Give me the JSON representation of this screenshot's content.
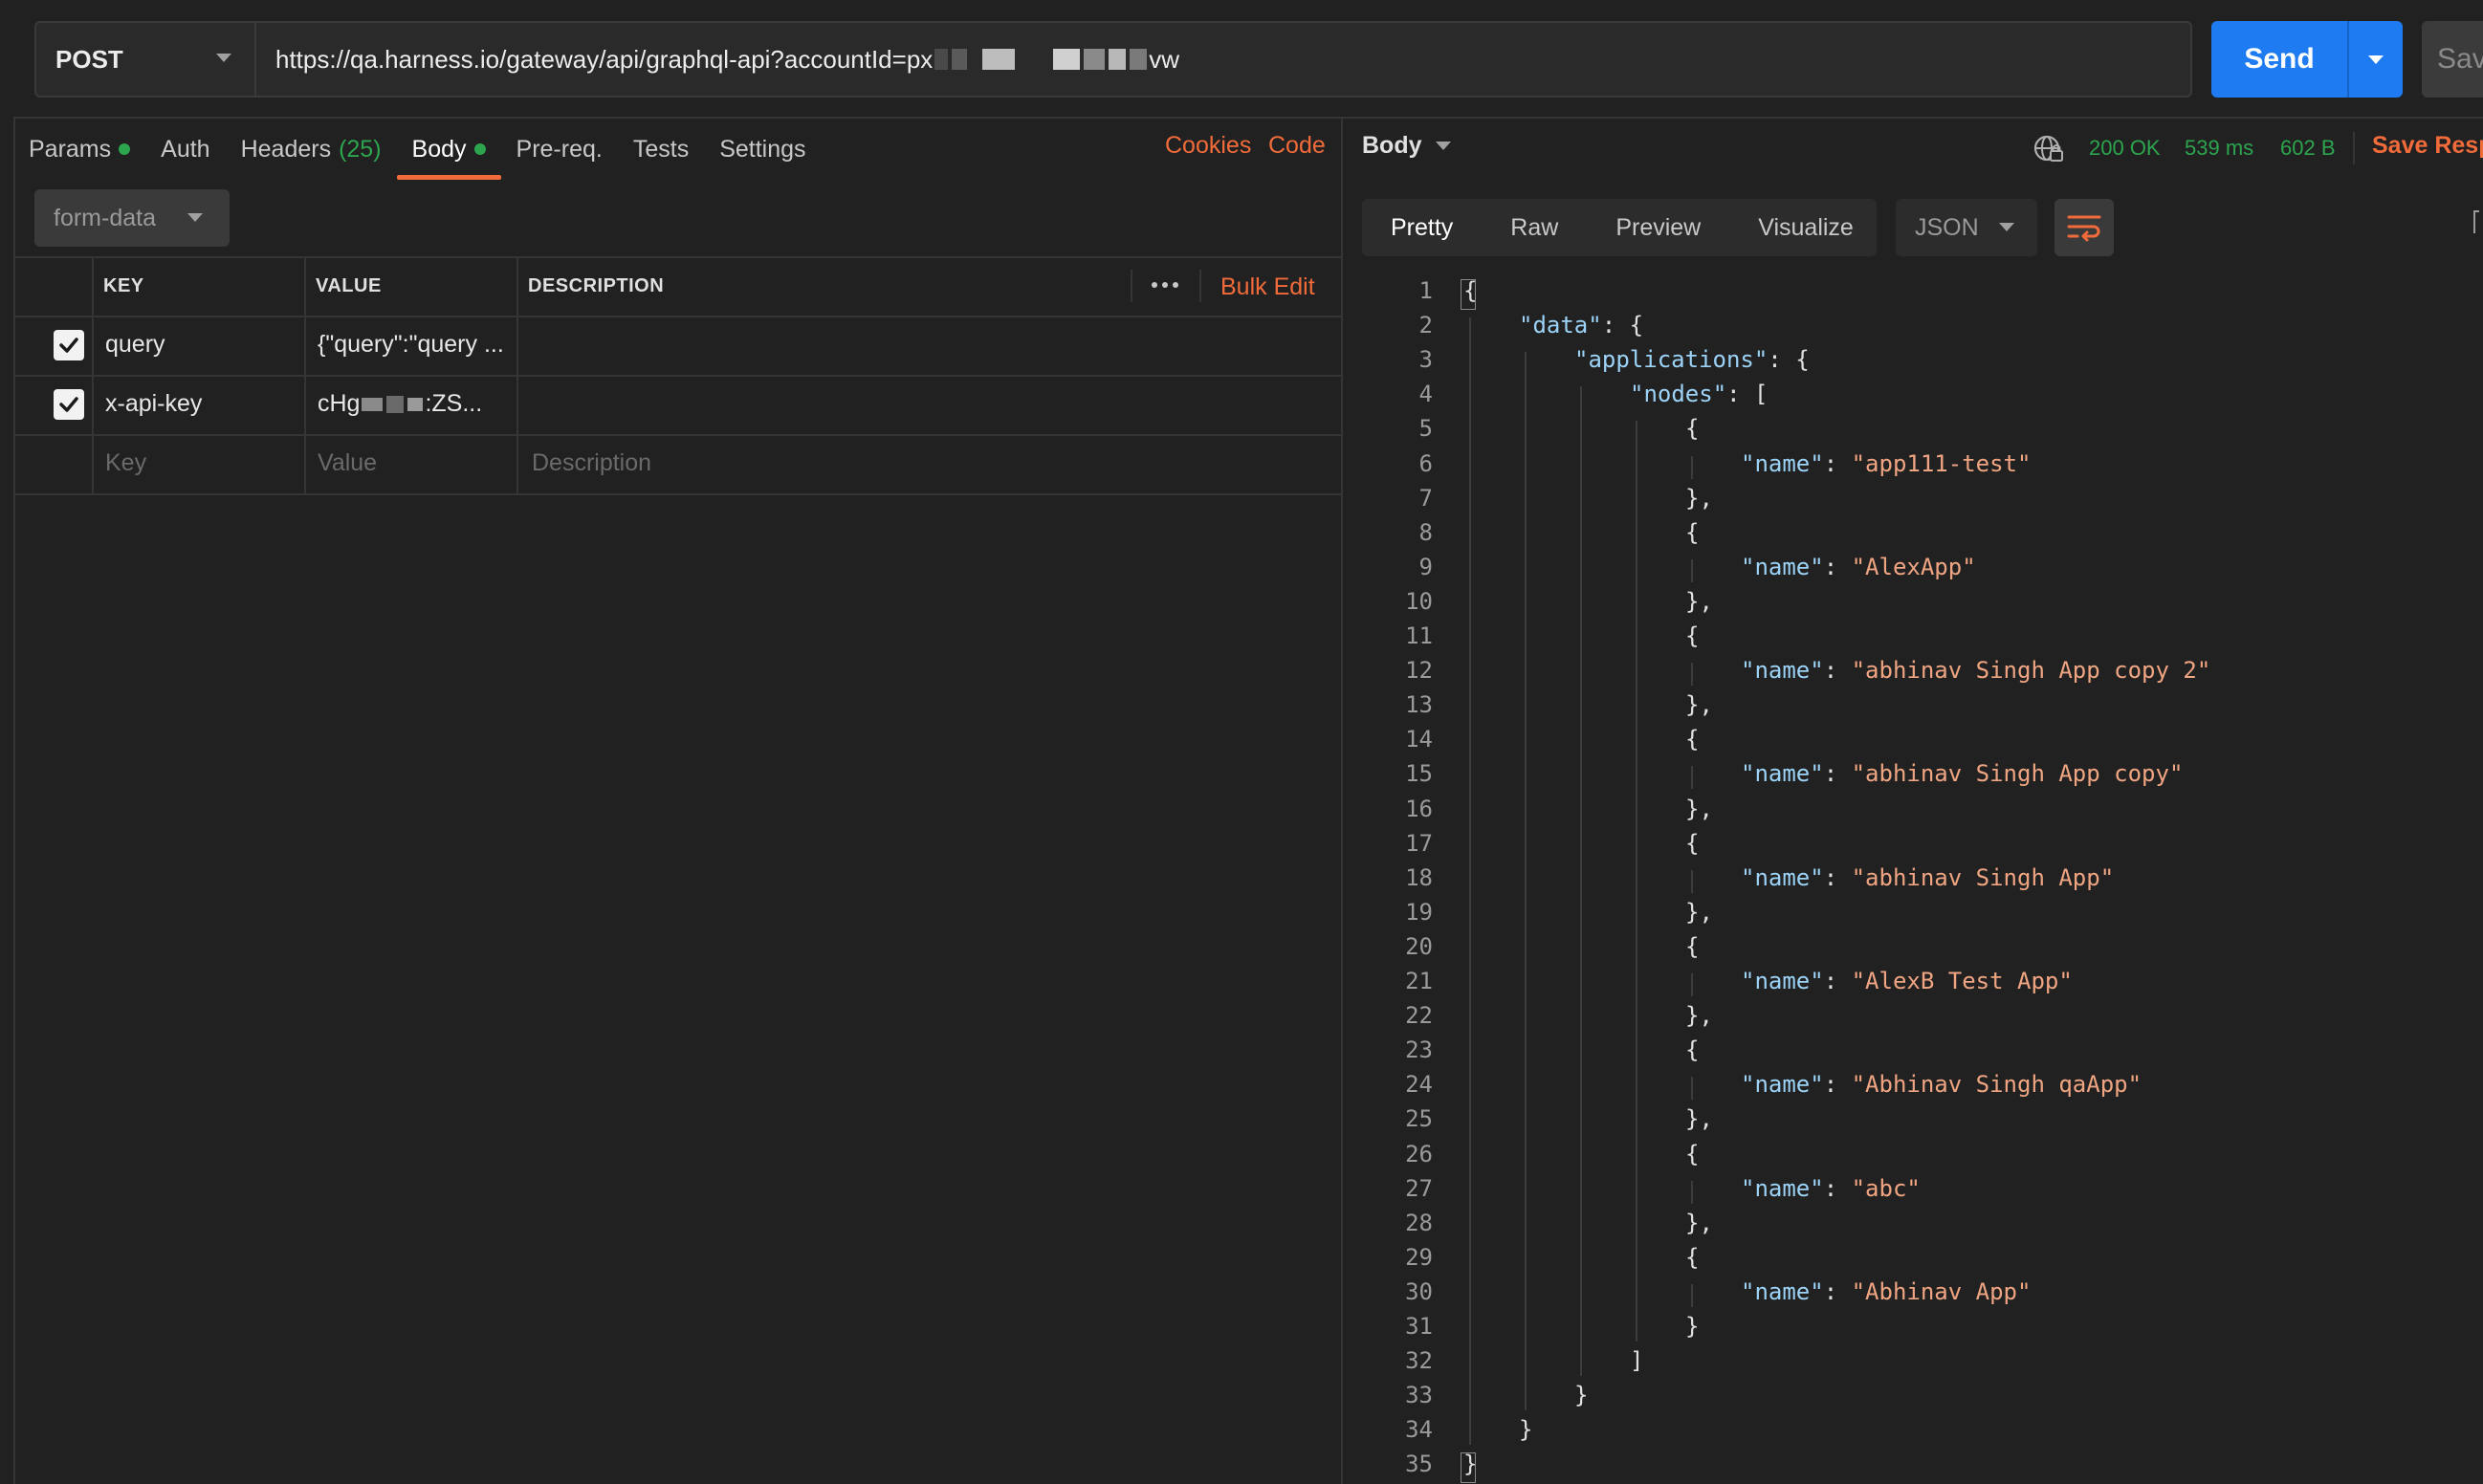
{
  "request": {
    "method": "POST",
    "url_prefix": "https://qa.harness.io/gateway/api/graphql-api?accountId=px",
    "url_suffix": "vw",
    "send_label": "Send",
    "save_label": "Sav"
  },
  "request_tabs": {
    "params": "Params",
    "auth": "Auth",
    "headers": "Headers",
    "headers_count": "(25)",
    "body": "Body",
    "prereq": "Pre-req.",
    "tests": "Tests",
    "settings": "Settings",
    "cookies": "Cookies",
    "code": "Code"
  },
  "body_mode": "form-data",
  "form_table": {
    "headers": {
      "key": "KEY",
      "value": "VALUE",
      "description": "DESCRIPTION"
    },
    "bulk_edit": "Bulk Edit",
    "rows": [
      {
        "checked": true,
        "key": "query",
        "value": "{\"query\":\"query ...",
        "description": ""
      },
      {
        "checked": true,
        "key": "x-api-key",
        "value_prefix": "cHg",
        "value_suffix": ":ZS...",
        "description": ""
      }
    ],
    "placeholder": {
      "key": "Key",
      "value": "Value",
      "description": "Description"
    }
  },
  "response": {
    "body_label": "Body",
    "status": "200 OK",
    "time": "539 ms",
    "size": "602 B",
    "save_response": "Save Resp",
    "view_tabs": [
      "Pretty",
      "Raw",
      "Preview",
      "Visualize"
    ],
    "format": "JSON",
    "line_numbers": [
      "1",
      "2",
      "3",
      "4",
      "5",
      "6",
      "7",
      "8",
      "9",
      "10",
      "11",
      "12",
      "13",
      "14",
      "15",
      "16",
      "17",
      "18",
      "19",
      "20",
      "21",
      "22",
      "23",
      "24",
      "25",
      "26",
      "27",
      "28",
      "29",
      "30",
      "31",
      "32",
      "33",
      "34",
      "35"
    ],
    "json": {
      "root_key": "\"data\"",
      "applications_key": "\"applications\"",
      "nodes_key": "\"nodes\"",
      "name_key": "\"name\"",
      "names": [
        "\"app111-test\"",
        "\"AlexApp\"",
        "\"abhinav Singh App copy 2\"",
        "\"abhinav Singh App copy\"",
        "\"abhinav Singh App\"",
        "\"AlexB Test App\"",
        "\"Abhinav Singh qaApp\"",
        "\"abc\"",
        "\"Abhinav App\""
      ]
    }
  }
}
